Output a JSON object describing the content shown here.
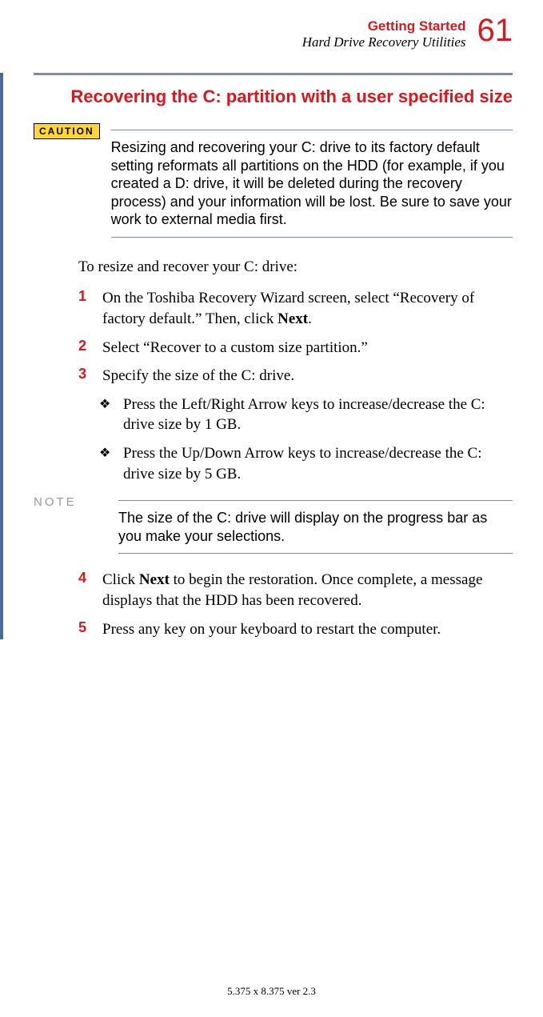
{
  "header": {
    "chapter": "Getting Started",
    "section": "Hard Drive Recovery Utilities",
    "page_number": "61"
  },
  "section_title": "Recovering the C: partition with a user specified size",
  "caution": {
    "label": "CAUTION",
    "text": "Resizing and recovering your C: drive to its factory default setting reformats all partitions on the HDD (for example, if you created a D: drive, it will be deleted during the recovery process) and your information will be lost. Be sure to save your work to external media first."
  },
  "intro": "To resize and recover your C: drive:",
  "steps": [
    {
      "num": "1",
      "pre": "On the Toshiba Recovery Wizard screen, select “Recovery of factory default.” Then, click ",
      "bold": "Next",
      "post": "."
    },
    {
      "num": "2",
      "pre": "Select “Recover to a custom size partition.”",
      "bold": "",
      "post": ""
    },
    {
      "num": "3",
      "pre": "Specify the size of the C: drive.",
      "bold": "",
      "post": ""
    }
  ],
  "sub_bullets": [
    "Press the Left/Right Arrow keys to increase/decrease the C: drive size by 1 GB.",
    "Press the Up/Down Arrow keys to increase/decrease the C: drive size by 5 GB."
  ],
  "note": {
    "label": "NOTE",
    "text": "The size of the C: drive will display on the progress bar as you make your selections."
  },
  "steps2": [
    {
      "num": "4",
      "pre": "Click ",
      "bold": "Next",
      "post": " to begin the restoration. Once complete, a message displays that the HDD has been recovered."
    },
    {
      "num": "5",
      "pre": "Press any key on your keyboard to restart the computer.",
      "bold": "",
      "post": ""
    }
  ],
  "footer": "5.375 x 8.375 ver 2.3"
}
